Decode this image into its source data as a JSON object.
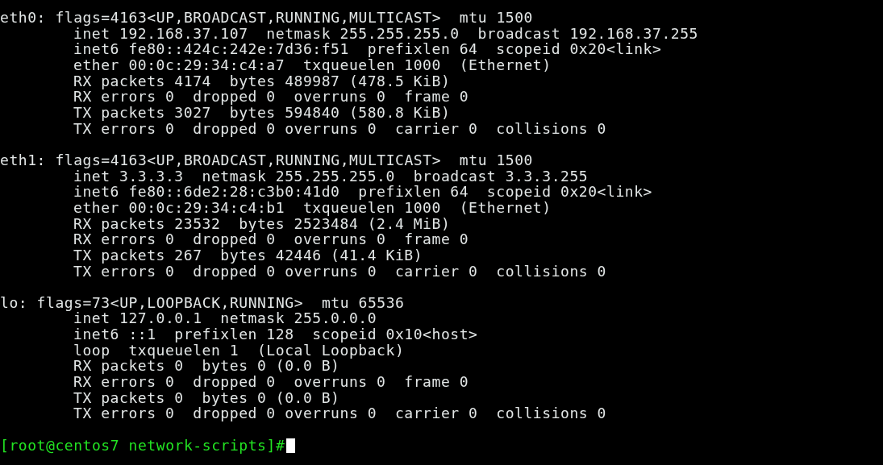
{
  "terminal": {
    "interfaces": [
      {
        "header": "eth0: flags=4163<UP,BROADCAST,RUNNING,MULTICAST>  mtu 1500",
        "details": [
          "inet 192.168.37.107  netmask 255.255.255.0  broadcast 192.168.37.255",
          "inet6 fe80::424c:242e:7d36:f51  prefixlen 64  scopeid 0x20<link>",
          "ether 00:0c:29:34:c4:a7  txqueuelen 1000  (Ethernet)",
          "RX packets 4174  bytes 489987 (478.5 KiB)",
          "RX errors 0  dropped 0  overruns 0  frame 0",
          "TX packets 3027  bytes 594840 (580.8 KiB)",
          "TX errors 0  dropped 0 overruns 0  carrier 0  collisions 0"
        ]
      },
      {
        "header": "eth1: flags=4163<UP,BROADCAST,RUNNING,MULTICAST>  mtu 1500",
        "details": [
          "inet 3.3.3.3  netmask 255.255.255.0  broadcast 3.3.3.255",
          "inet6 fe80::6de2:28:c3b0:41d0  prefixlen 64  scopeid 0x20<link>",
          "ether 00:0c:29:34:c4:b1  txqueuelen 1000  (Ethernet)",
          "RX packets 23532  bytes 2523484 (2.4 MiB)",
          "RX errors 0  dropped 0  overruns 0  frame 0",
          "TX packets 267  bytes 42446 (41.4 KiB)",
          "TX errors 0  dropped 0 overruns 0  carrier 0  collisions 0"
        ]
      },
      {
        "header": "lo: flags=73<UP,LOOPBACK,RUNNING>  mtu 65536",
        "details": [
          "inet 127.0.0.1  netmask 255.0.0.0",
          "inet6 ::1  prefixlen 128  scopeid 0x10<host>",
          "loop  txqueuelen 1  (Local Loopback)",
          "RX packets 0  bytes 0 (0.0 B)",
          "RX errors 0  dropped 0  overruns 0  frame 0",
          "TX packets 0  bytes 0 (0.0 B)",
          "TX errors 0  dropped 0 overruns 0  carrier 0  collisions 0"
        ]
      }
    ],
    "prompt": {
      "text": "[root@centos7 network-scripts]#",
      "cursor": true
    }
  }
}
